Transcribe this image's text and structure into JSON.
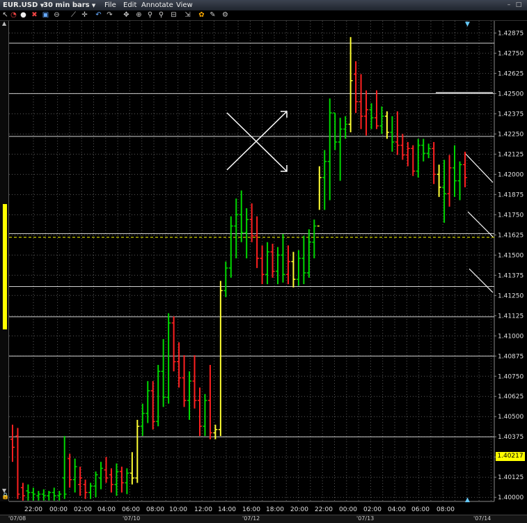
{
  "toolbar": {
    "symbol": "EUR.USD",
    "interval": "30 min bars",
    "menus": [
      "File",
      "Edit",
      "Annotate",
      "View"
    ]
  },
  "colors": {
    "up": "#00d800",
    "down": "#ff2020",
    "neutral": "#ffff33",
    "grid": "#5a5a5a",
    "hline": "#cfcfcf",
    "current_price_line": "#ffff00"
  },
  "current_price": "1.40217",
  "chart_data": {
    "type": "ohlc",
    "y_ticks": [
      "1.42875",
      "1.42750",
      "1.42625",
      "1.42500",
      "1.42375",
      "1.42250",
      "1.42125",
      "1.42000",
      "1.41875",
      "1.41750",
      "1.41625",
      "1.41500",
      "1.41375",
      "1.41250",
      "1.41125",
      "1.41000",
      "1.40875",
      "1.40750",
      "1.40625",
      "1.40500",
      "1.40375",
      "1.40250",
      "1.40125",
      "1.40000"
    ],
    "ylim": [
      1.39975,
      1.4295
    ],
    "x_ticks": [
      "22:00",
      "00:00",
      "02:00",
      "04:00",
      "06:00",
      "08:00",
      "10:00",
      "12:00",
      "14:00",
      "16:00",
      "18:00",
      "20:00",
      "22:00",
      "00:00",
      "02:00",
      "04:00",
      "06:00",
      "08:00"
    ],
    "date_labels": [
      "'07/08",
      "'07/10",
      "'07/12",
      "'07/13",
      "'07/14"
    ],
    "horizontal_lines": [
      1.42812,
      1.425,
      1.42235,
      1.41633,
      1.41305,
      1.41118,
      1.40875,
      1.40375
    ],
    "dashed_price_line": 1.4161,
    "bars": [
      {
        "o": 1.4036,
        "h": 1.4045,
        "l": 1.4022,
        "c": 1.4031,
        "d": "down"
      },
      {
        "o": 1.4038,
        "h": 1.4043,
        "l": 1.3999,
        "c": 1.4002,
        "d": "down"
      },
      {
        "o": 1.4006,
        "h": 1.4009,
        "l": 1.3998,
        "c": 1.4001,
        "d": "down"
      },
      {
        "o": 1.4004,
        "h": 1.4008,
        "l": 1.3998,
        "c": 1.4003,
        "d": "up"
      },
      {
        "o": 1.4003,
        "h": 1.4006,
        "l": 1.3998,
        "c": 1.4002,
        "d": "up"
      },
      {
        "o": 1.4001,
        "h": 1.4004,
        "l": 1.3998,
        "c": 1.4002,
        "d": "up"
      },
      {
        "o": 1.4002,
        "h": 1.4005,
        "l": 1.3998,
        "c": 1.4001,
        "d": "up"
      },
      {
        "o": 1.4001,
        "h": 1.4004,
        "l": 1.3998,
        "c": 1.4003,
        "d": "up"
      },
      {
        "o": 1.4003,
        "h": 1.4006,
        "l": 1.3998,
        "c": 1.4001,
        "d": "up"
      },
      {
        "o": 1.4001,
        "h": 1.4004,
        "l": 1.3998,
        "c": 1.4002,
        "d": "up"
      },
      {
        "o": 1.4012,
        "h": 1.4038,
        "l": 1.3999,
        "c": 1.4002,
        "d": "up"
      },
      {
        "o": 1.4024,
        "h": 1.4027,
        "l": 1.4006,
        "c": 1.4011,
        "d": "down"
      },
      {
        "o": 1.4011,
        "h": 1.4024,
        "l": 1.4003,
        "c": 1.4019,
        "d": "up"
      },
      {
        "o": 1.4008,
        "h": 1.4019,
        "l": 1.4001,
        "c": 1.4012,
        "d": "down"
      },
      {
        "o": 1.4008,
        "h": 1.4011,
        "l": 1.3999,
        "c": 1.4003,
        "d": "down"
      },
      {
        "o": 1.4003,
        "h": 1.4009,
        "l": 1.3999,
        "c": 1.4007,
        "d": "up"
      },
      {
        "o": 1.4007,
        "h": 1.4016,
        "l": 1.4,
        "c": 1.4014,
        "d": "up"
      },
      {
        "o": 1.4012,
        "h": 1.4022,
        "l": 1.4005,
        "c": 1.4018,
        "d": "up"
      },
      {
        "o": 1.4017,
        "h": 1.4025,
        "l": 1.4009,
        "c": 1.4012,
        "d": "down"
      },
      {
        "o": 1.4014,
        "h": 1.4018,
        "l": 1.4003,
        "c": 1.4008,
        "d": "down"
      },
      {
        "o": 1.4008,
        "h": 1.4021,
        "l": 1.4001,
        "c": 1.4016,
        "d": "up"
      },
      {
        "o": 1.4016,
        "h": 1.4019,
        "l": 1.4003,
        "c": 1.4009,
        "d": "down"
      },
      {
        "o": 1.4009,
        "h": 1.4018,
        "l": 1.4002,
        "c": 1.4015,
        "d": "up"
      },
      {
        "o": 1.4015,
        "h": 1.4028,
        "l": 1.4008,
        "c": 1.4012,
        "d": "neutral"
      },
      {
        "o": 1.4012,
        "h": 1.4048,
        "l": 1.4009,
        "c": 1.4044,
        "d": "neutral"
      },
      {
        "o": 1.4044,
        "h": 1.4058,
        "l": 1.4038,
        "c": 1.4052,
        "d": "up"
      },
      {
        "o": 1.4052,
        "h": 1.4072,
        "l": 1.4046,
        "c": 1.4066,
        "d": "up"
      },
      {
        "o": 1.4066,
        "h": 1.4072,
        "l": 1.4042,
        "c": 1.4047,
        "d": "down"
      },
      {
        "o": 1.4047,
        "h": 1.4082,
        "l": 1.4044,
        "c": 1.4078,
        "d": "up"
      },
      {
        "o": 1.4078,
        "h": 1.4098,
        "l": 1.4056,
        "c": 1.4062,
        "d": "up"
      },
      {
        "o": 1.4062,
        "h": 1.4114,
        "l": 1.4058,
        "c": 1.4108,
        "d": "up"
      },
      {
        "o": 1.4108,
        "h": 1.4112,
        "l": 1.4078,
        "c": 1.4084,
        "d": "down"
      },
      {
        "o": 1.4084,
        "h": 1.4096,
        "l": 1.4068,
        "c": 1.4074,
        "d": "down"
      },
      {
        "o": 1.4074,
        "h": 1.4088,
        "l": 1.4056,
        "c": 1.406,
        "d": "down"
      },
      {
        "o": 1.406,
        "h": 1.4078,
        "l": 1.4048,
        "c": 1.4072,
        "d": "up"
      },
      {
        "o": 1.4072,
        "h": 1.4088,
        "l": 1.4055,
        "c": 1.406,
        "d": "down"
      },
      {
        "o": 1.406,
        "h": 1.4068,
        "l": 1.4038,
        "c": 1.4044,
        "d": "down"
      },
      {
        "o": 1.4044,
        "h": 1.4064,
        "l": 1.4038,
        "c": 1.406,
        "d": "up"
      },
      {
        "o": 1.406,
        "h": 1.4082,
        "l": 1.4036,
        "c": 1.404,
        "d": "down"
      },
      {
        "o": 1.404,
        "h": 1.4045,
        "l": 1.4036,
        "c": 1.4042,
        "d": "neutral"
      },
      {
        "o": 1.4042,
        "h": 1.4134,
        "l": 1.4038,
        "c": 1.4128,
        "d": "neutral"
      },
      {
        "o": 1.4128,
        "h": 1.4146,
        "l": 1.4124,
        "c": 1.4142,
        "d": "up"
      },
      {
        "o": 1.4142,
        "h": 1.4174,
        "l": 1.4136,
        "c": 1.4168,
        "d": "up"
      },
      {
        "o": 1.4168,
        "h": 1.4185,
        "l": 1.4148,
        "c": 1.4175,
        "d": "up"
      },
      {
        "o": 1.4175,
        "h": 1.419,
        "l": 1.4158,
        "c": 1.4164,
        "d": "up"
      },
      {
        "o": 1.4164,
        "h": 1.4179,
        "l": 1.4148,
        "c": 1.4172,
        "d": "up"
      },
      {
        "o": 1.4172,
        "h": 1.4182,
        "l": 1.4158,
        "c": 1.4162,
        "d": "down"
      },
      {
        "o": 1.4162,
        "h": 1.4174,
        "l": 1.4142,
        "c": 1.4148,
        "d": "down"
      },
      {
        "o": 1.4148,
        "h": 1.4156,
        "l": 1.4132,
        "c": 1.4138,
        "d": "down"
      },
      {
        "o": 1.4138,
        "h": 1.4158,
        "l": 1.4132,
        "c": 1.4152,
        "d": "up"
      },
      {
        "o": 1.4152,
        "h": 1.4157,
        "l": 1.4136,
        "c": 1.414,
        "d": "down"
      },
      {
        "o": 1.414,
        "h": 1.4155,
        "l": 1.4132,
        "c": 1.415,
        "d": "up"
      },
      {
        "o": 1.415,
        "h": 1.4163,
        "l": 1.4133,
        "c": 1.4138,
        "d": "up"
      },
      {
        "o": 1.4138,
        "h": 1.4156,
        "l": 1.4132,
        "c": 1.4146,
        "d": "down"
      },
      {
        "o": 1.4146,
        "h": 1.4152,
        "l": 1.413,
        "c": 1.4135,
        "d": "neutral"
      },
      {
        "o": 1.4135,
        "h": 1.4153,
        "l": 1.4131,
        "c": 1.4148,
        "d": "up"
      },
      {
        "o": 1.4148,
        "h": 1.4162,
        "l": 1.4132,
        "c": 1.4139,
        "d": "up"
      },
      {
        "o": 1.4139,
        "h": 1.4166,
        "l": 1.4136,
        "c": 1.4158,
        "d": "up"
      },
      {
        "o": 1.4158,
        "h": 1.4172,
        "l": 1.4148,
        "c": 1.4168,
        "d": "up"
      },
      {
        "o": 1.4168,
        "h": 1.4205,
        "l": 1.4178,
        "c": 1.4198,
        "d": "neutral"
      },
      {
        "o": 1.4198,
        "h": 1.4215,
        "l": 1.4178,
        "c": 1.4208,
        "d": "up"
      },
      {
        "o": 1.4208,
        "h": 1.4247,
        "l": 1.4184,
        "c": 1.4238,
        "d": "up"
      },
      {
        "o": 1.4238,
        "h": 1.4238,
        "l": 1.4215,
        "c": 1.422,
        "d": "up"
      },
      {
        "o": 1.422,
        "h": 1.4235,
        "l": 1.4196,
        "c": 1.4228,
        "d": "up"
      },
      {
        "o": 1.4228,
        "h": 1.4236,
        "l": 1.4222,
        "c": 1.4231,
        "d": "up"
      },
      {
        "o": 1.4231,
        "h": 1.4285,
        "l": 1.4226,
        "c": 1.4258,
        "d": "neutral"
      },
      {
        "o": 1.4262,
        "h": 1.427,
        "l": 1.4238,
        "c": 1.4245,
        "d": "down"
      },
      {
        "o": 1.4245,
        "h": 1.4262,
        "l": 1.4228,
        "c": 1.4236,
        "d": "down"
      },
      {
        "o": 1.4236,
        "h": 1.4252,
        "l": 1.4224,
        "c": 1.424,
        "d": "down"
      },
      {
        "o": 1.424,
        "h": 1.4244,
        "l": 1.4228,
        "c": 1.4235,
        "d": "up"
      },
      {
        "o": 1.4235,
        "h": 1.4252,
        "l": 1.4228,
        "c": 1.423,
        "d": "down"
      },
      {
        "o": 1.423,
        "h": 1.4242,
        "l": 1.4225,
        "c": 1.4236,
        "d": "up"
      },
      {
        "o": 1.4236,
        "h": 1.4239,
        "l": 1.4222,
        "c": 1.4226,
        "d": "neutral"
      },
      {
        "o": 1.4226,
        "h": 1.4236,
        "l": 1.4214,
        "c": 1.422,
        "d": "up"
      },
      {
        "o": 1.422,
        "h": 1.4239,
        "l": 1.4212,
        "c": 1.4218,
        "d": "down"
      },
      {
        "o": 1.4218,
        "h": 1.4225,
        "l": 1.4209,
        "c": 1.4212,
        "d": "down"
      },
      {
        "o": 1.4212,
        "h": 1.422,
        "l": 1.4205,
        "c": 1.4216,
        "d": "down"
      },
      {
        "o": 1.4216,
        "h": 1.4218,
        "l": 1.4199,
        "c": 1.4202,
        "d": "down"
      },
      {
        "o": 1.4202,
        "h": 1.4222,
        "l": 1.4198,
        "c": 1.4218,
        "d": "up"
      },
      {
        "o": 1.4218,
        "h": 1.4222,
        "l": 1.4208,
        "c": 1.4213,
        "d": "up"
      },
      {
        "o": 1.4213,
        "h": 1.4219,
        "l": 1.421,
        "c": 1.4216,
        "d": "up"
      },
      {
        "o": 1.4216,
        "h": 1.422,
        "l": 1.4194,
        "c": 1.42,
        "d": "down"
      },
      {
        "o": 1.42,
        "h": 1.4206,
        "l": 1.4186,
        "c": 1.4192,
        "d": "neutral"
      },
      {
        "o": 1.4192,
        "h": 1.4209,
        "l": 1.417,
        "c": 1.4188,
        "d": "up"
      },
      {
        "o": 1.4188,
        "h": 1.4212,
        "l": 1.418,
        "c": 1.4204,
        "d": "down"
      },
      {
        "o": 1.4204,
        "h": 1.4218,
        "l": 1.4186,
        "c": 1.4196,
        "d": "up"
      },
      {
        "o": 1.4196,
        "h": 1.4208,
        "l": 1.4184,
        "c": 1.4206,
        "d": "up"
      },
      {
        "o": 1.4206,
        "h": 1.4214,
        "l": 1.4192,
        "c": 1.4198,
        "d": "down"
      }
    ]
  }
}
